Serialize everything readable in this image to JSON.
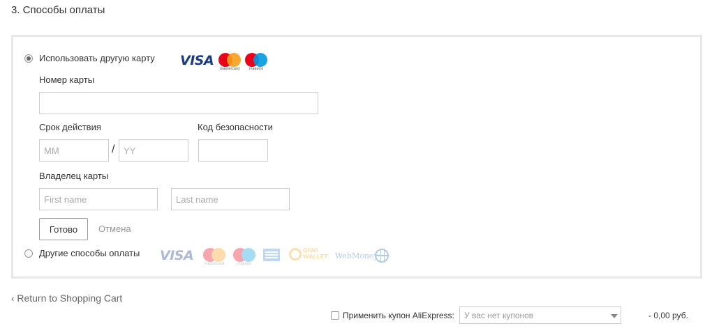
{
  "section": {
    "title": "3. Способы оплаты"
  },
  "card_option": {
    "label": "Использовать другую карту",
    "selected": true,
    "logos": {
      "visa": "VISA",
      "mastercard_caption": "mastercard",
      "maestro_caption": "maestro"
    }
  },
  "form": {
    "card_number_label": "Номер карты",
    "card_number_value": "",
    "expiry_label": "Срок действия",
    "month_placeholder": "MM",
    "year_placeholder": "YY",
    "separator": "/",
    "cvv_label": "Код безопасности",
    "cvv_value": "",
    "holder_label": "Владелец карты",
    "first_name_placeholder": "First name",
    "last_name_placeholder": "Last name",
    "done_button": "Готово",
    "cancel_link": "Отмена"
  },
  "other_option": {
    "label": "Другие способы оплаты",
    "selected": false,
    "logos": {
      "visa": "VISA",
      "mastercard_caption": "mastercard",
      "maestro_caption": "maestro",
      "qiwi": "QIWI\nWALLET",
      "webmoney": "WebMoney"
    }
  },
  "footer": {
    "return_chevron": "‹",
    "return_link": "Return to Shopping Cart",
    "coupon_label": "Применить купон AliExpress:",
    "coupon_selected": "У вас нет купонов",
    "discount": "- 0,00 руб."
  },
  "colors": {
    "visa_blue": "#1a3b7f",
    "mc_red": "#eb001b",
    "mc_orange": "#f79e1b",
    "maestro_blue": "#0099df",
    "panel_border": "#e8e8e8"
  }
}
